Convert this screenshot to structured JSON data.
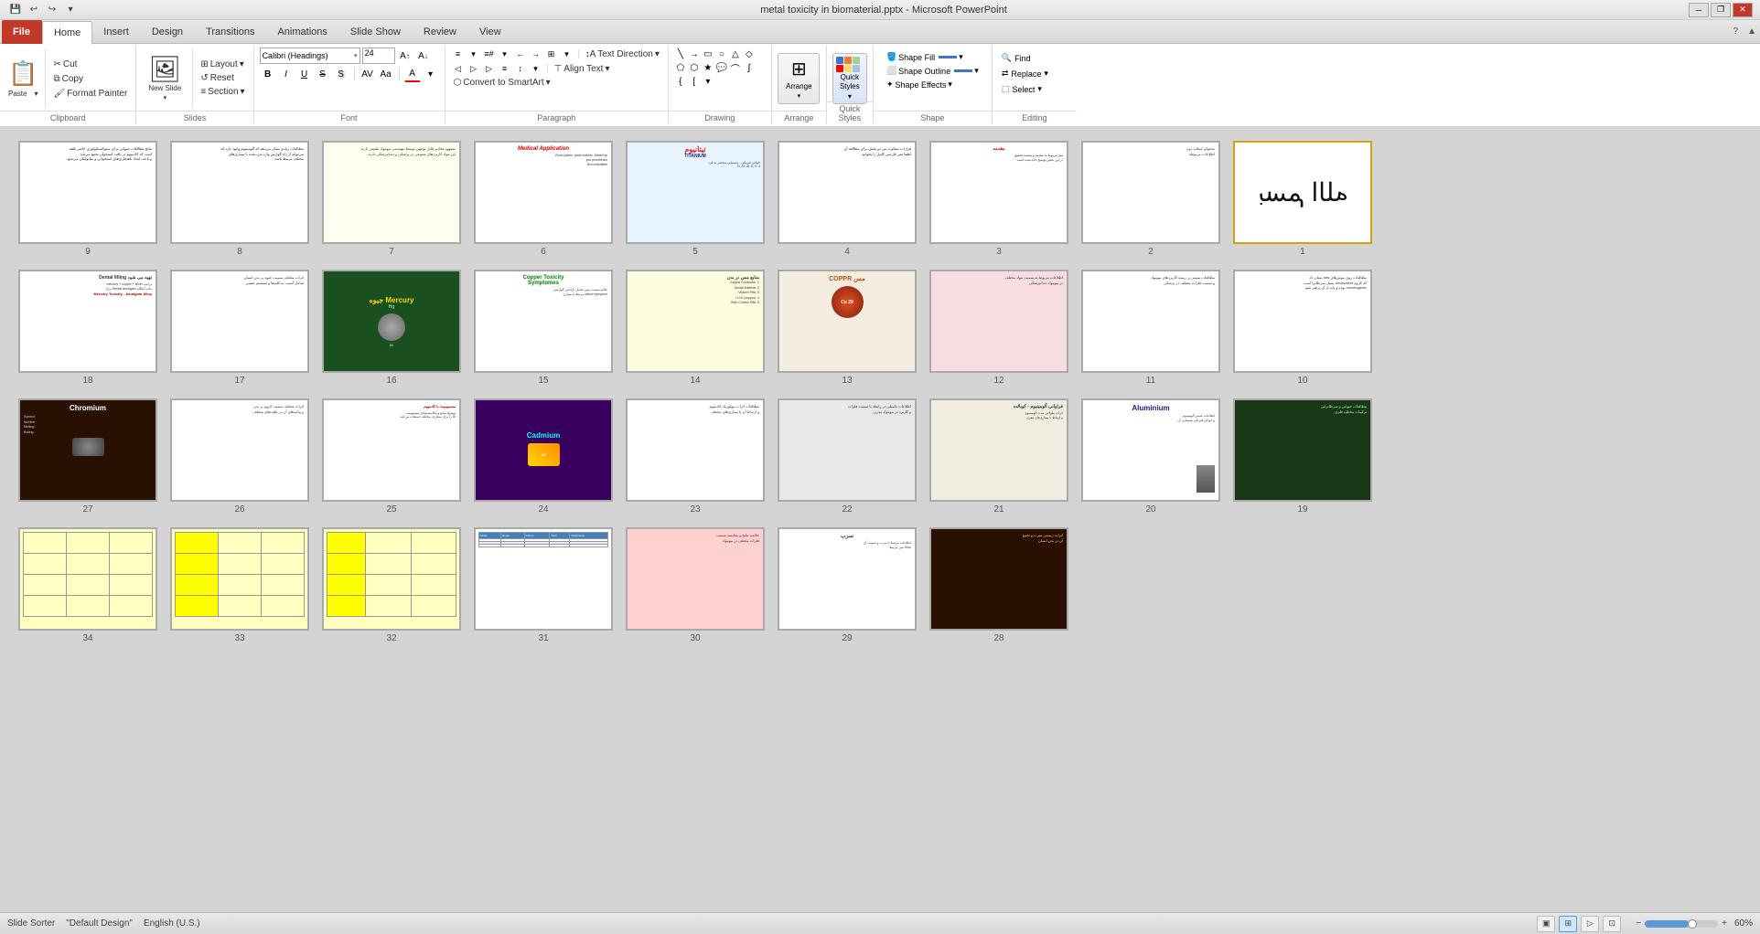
{
  "titlebar": {
    "title": "metal toxicity in biomaterial.pptx - Microsoft PowerPoint",
    "quickaccess": [
      "save",
      "undo",
      "redo"
    ],
    "window_controls": [
      "minimize",
      "restore",
      "close"
    ]
  },
  "ribbon": {
    "tabs": [
      "File",
      "Home",
      "Insert",
      "Design",
      "Transitions",
      "Animations",
      "Slide Show",
      "Review",
      "View"
    ],
    "active_tab": "Home",
    "file_tab": "File",
    "groups": {
      "clipboard": {
        "label": "Clipboard",
        "paste": "Paste",
        "cut": "Cut",
        "copy": "Copy",
        "format_painter": "Format Painter"
      },
      "slides": {
        "label": "Slides",
        "new_slide": "New Slide",
        "layout": "Layout",
        "reset": "Reset",
        "section": "Section"
      },
      "font": {
        "label": "Font",
        "font_name": "Calibri (Headings)",
        "font_size": "24",
        "bold": "B",
        "italic": "I",
        "underline": "U",
        "strikethrough": "S",
        "shadow": "S",
        "increase_size": "A↑",
        "decrease_size": "A↓",
        "change_case": "Aa",
        "font_color": "A"
      },
      "paragraph": {
        "label": "Paragraph",
        "bullets": "≡",
        "numbering": "≡#",
        "text_direction": "Text Direction",
        "align_text": "Align Text",
        "convert_smartart": "Convert to SmartArt",
        "decrease_indent": "←",
        "increase_indent": "→",
        "align_left": "◁",
        "align_center": "▷",
        "align_right": "▷",
        "justify": "≡",
        "columns": "⊞",
        "line_spacing": "↕"
      },
      "drawing": {
        "label": "Drawing",
        "shapes": "Shapes"
      },
      "arrange": {
        "label": "Arrange",
        "arrange_btn": "Arrange"
      },
      "quick_styles": {
        "label": "Quick Styles"
      },
      "shape_tools": {
        "shape_fill": "Shape Fill",
        "shape_outline": "Shape Outline",
        "shape_effects": "Shape Effects"
      },
      "editing": {
        "label": "Editing",
        "find": "Find",
        "replace": "Replace",
        "select": "Select"
      }
    }
  },
  "slides": [
    {
      "num": 1,
      "bg": "white",
      "selected": true,
      "content_type": "calligraphy"
    },
    {
      "num": 2,
      "bg": "white",
      "content_type": "text_rtl"
    },
    {
      "num": 3,
      "bg": "white",
      "content_type": "text_rtl"
    },
    {
      "num": 4,
      "bg": "white",
      "content_type": "text_rtl"
    },
    {
      "num": 5,
      "bg": "light_blue",
      "content_type": "titanium"
    },
    {
      "num": 6,
      "bg": "pink",
      "content_type": "medical"
    },
    {
      "num": 7,
      "bg": "light_cream",
      "content_type": "text_rtl"
    },
    {
      "num": 8,
      "bg": "white",
      "content_type": "text_rtl"
    },
    {
      "num": 9,
      "bg": "white",
      "content_type": "text_rtl"
    },
    {
      "num": 10,
      "bg": "white",
      "content_type": "text_rtl"
    },
    {
      "num": 11,
      "bg": "white",
      "content_type": "text_rtl"
    },
    {
      "num": 12,
      "bg": "pink_light",
      "content_type": "pink_slide"
    },
    {
      "num": 13,
      "bg": "beige",
      "content_type": "coppr"
    },
    {
      "num": 14,
      "bg": "yellow_light",
      "content_type": "copper_list"
    },
    {
      "num": 15,
      "bg": "white",
      "content_type": "copper_toxicity"
    },
    {
      "num": 16,
      "bg": "dark_green",
      "content_type": "mercury"
    },
    {
      "num": 17,
      "bg": "white",
      "content_type": "text_rtl"
    },
    {
      "num": 18,
      "bg": "white",
      "content_type": "dental_filling"
    },
    {
      "num": 19,
      "bg": "dark_green2",
      "content_type": "dark_slide"
    },
    {
      "num": 20,
      "bg": "white",
      "content_type": "aluminium"
    },
    {
      "num": 21,
      "bg": "gray_light",
      "content_type": "text_rtl"
    },
    {
      "num": 22,
      "bg": "gray_light2",
      "content_type": "text_rtl"
    },
    {
      "num": 23,
      "bg": "white",
      "content_type": "text_rtl"
    },
    {
      "num": 24,
      "bg": "purple",
      "content_type": "cadmium"
    },
    {
      "num": 25,
      "bg": "white",
      "content_type": "text_rtl"
    },
    {
      "num": 26,
      "bg": "white",
      "content_type": "text_rtl"
    },
    {
      "num": 27,
      "bg": "brown",
      "content_type": "chromium"
    },
    {
      "num": 28,
      "bg": "dark_brown",
      "content_type": "text_dark"
    },
    {
      "num": 29,
      "bg": "white",
      "content_type": "sorb"
    },
    {
      "num": 30,
      "bg": "pink_light2",
      "content_type": "text_rtl"
    },
    {
      "num": 31,
      "bg": "table_slide",
      "content_type": "table"
    },
    {
      "num": 32,
      "bg": "yellow_table",
      "content_type": "table2"
    },
    {
      "num": 33,
      "bg": "yellow_table2",
      "content_type": "table3"
    },
    {
      "num": 34,
      "bg": "yellow_table3",
      "content_type": "table4"
    }
  ],
  "statusbar": {
    "slide_sorter": "Slide Sorter",
    "theme": "\"Default Design\"",
    "language": "English (U.S.)",
    "zoom": "60%",
    "view_normal": "▣",
    "view_sorter": "⊞",
    "view_reading": "📖",
    "view_slideshow": "▶"
  }
}
